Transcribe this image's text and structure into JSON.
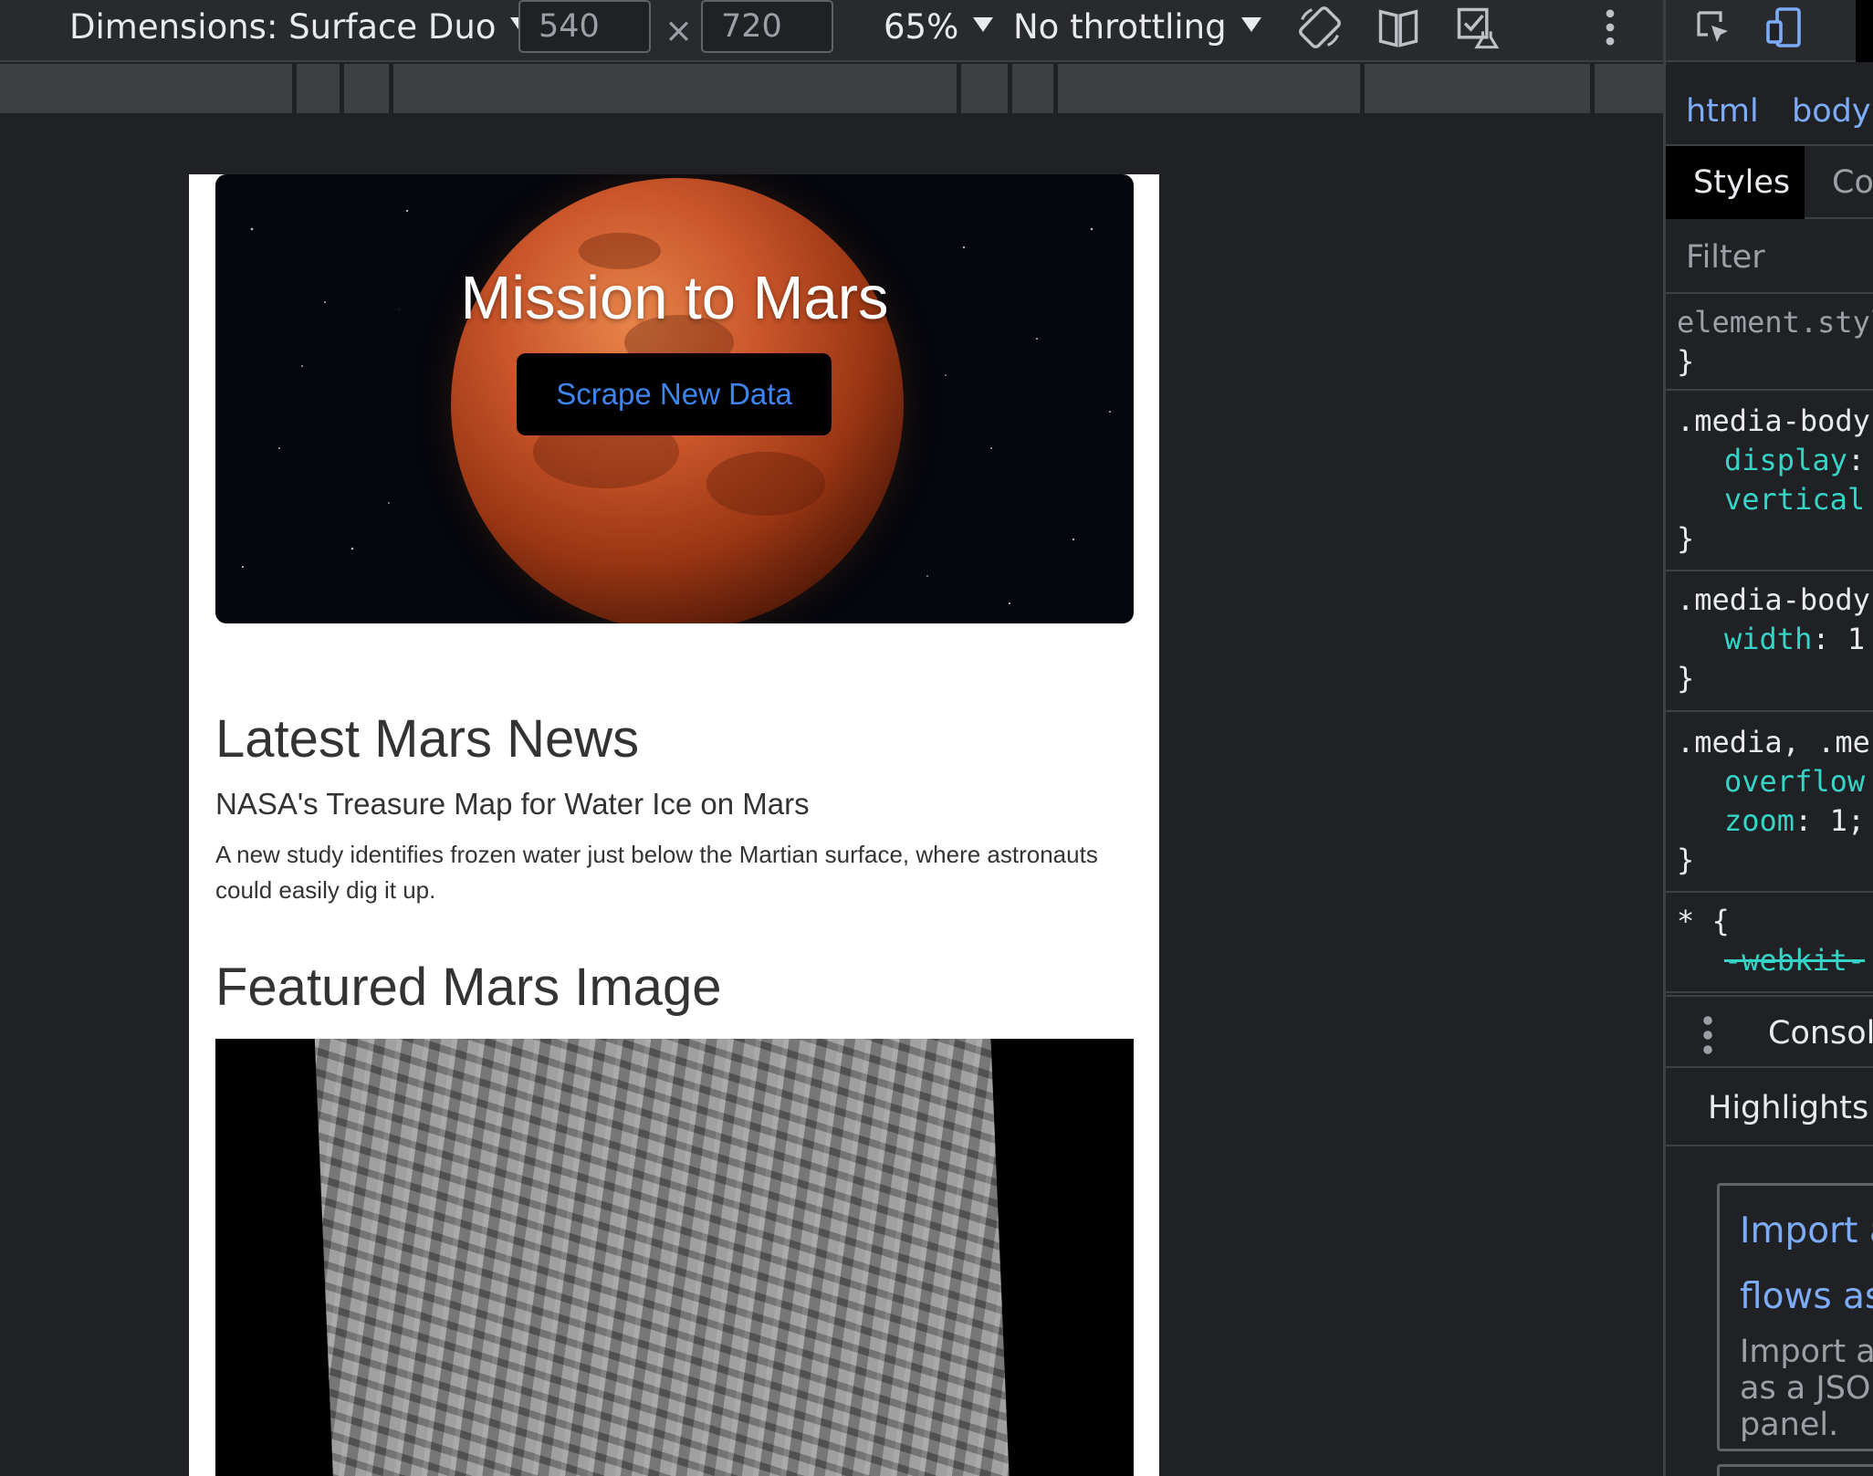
{
  "toolbar": {
    "dimensions_label": "Dimensions: Surface Duo",
    "width_value": "540",
    "height_value": "720",
    "times_symbol": "×",
    "zoom_label": "65%",
    "throttling_label": "No throttling"
  },
  "page": {
    "hero_title": "Mission to Mars",
    "scrape_button_label": "Scrape New Data",
    "news_heading": "Latest Mars News",
    "news_title": "NASA's Treasure Map for Water Ice on Mars",
    "news_body": "A new study identifies frozen water just below the Martian surface, where astronauts could easily dig it up.",
    "featured_heading": "Featured Mars Image"
  },
  "devtools": {
    "breadcrumbs": [
      "html",
      "body"
    ],
    "tabs": [
      "Styles",
      "Com"
    ],
    "filter_placeholder": "Filter",
    "rules": {
      "element_style": "element.style {",
      "media_body_1": ".media-body {",
      "media_body_1_props": [
        {
          "name": "display",
          "value": ":"
        },
        {
          "name": "vertical",
          "value": ""
        }
      ],
      "media_body_2": ".media-body {",
      "media_body_2_props": [
        {
          "name": "width",
          "value": ": 1"
        }
      ],
      "media_multi": ".media, .me",
      "media_multi_props": [
        {
          "name": "overflow",
          "value": ""
        },
        {
          "name": "zoom",
          "value": ": 1;"
        }
      ],
      "universal": "* {",
      "universal_props": [
        {
          "name": "-webkit-",
          "value": ""
        }
      ],
      "close_brace": "}"
    },
    "drawer_label": "Console",
    "highlights_label": "Highlights f",
    "whatsnew_link_line1": "Import a",
    "whatsnew_link_line2": "flows as",
    "whatsnew_text_line1": "Import a",
    "whatsnew_text_line2": "as a JSO",
    "whatsnew_text_line3": "panel."
  },
  "icons": {
    "rotate": "rotate-icon",
    "dual_screen": "dual-screen-icon",
    "experiments": "experiments-icon",
    "more": "more-vert-icon",
    "inspect": "inspect-element-icon",
    "device_toggle": "device-toolbar-icon"
  },
  "colors": {
    "devtools_bg": "#202124",
    "link_blue": "#7cacf8",
    "css_prop_teal": "#35d4c7",
    "button_text_blue": "#3d85f0"
  }
}
